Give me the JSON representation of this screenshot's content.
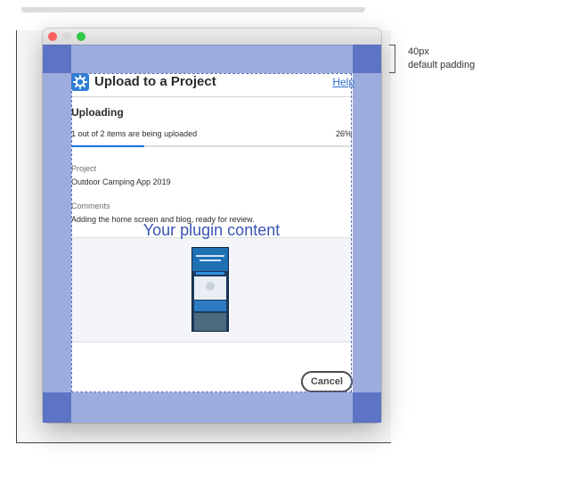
{
  "dialog": {
    "title": "Upload to a Project",
    "help_link": "Help",
    "icon": "gear-icon",
    "accent_color": "#2f7fd8",
    "uploading_heading": "Uploading",
    "progress_text": "1 out of 2 items are being uploaded",
    "progress_percent_label": "26%",
    "progress_value": 0.26,
    "project_label": "Project",
    "project_value": "Outdoor Camping App 2019",
    "comments_label": "Comments",
    "comments_value": "Adding the home screen and blog, ready for review.",
    "plugin_caption": "Your plugin content",
    "cancel_label": "Cancel"
  },
  "annotation": {
    "size": "40px",
    "label": "default padding"
  },
  "colors": {
    "padding_overlay": "#5f7ac8",
    "progress_fill": "#1473e6",
    "window_close": "#fc605c",
    "window_zoom": "#34c84a"
  }
}
